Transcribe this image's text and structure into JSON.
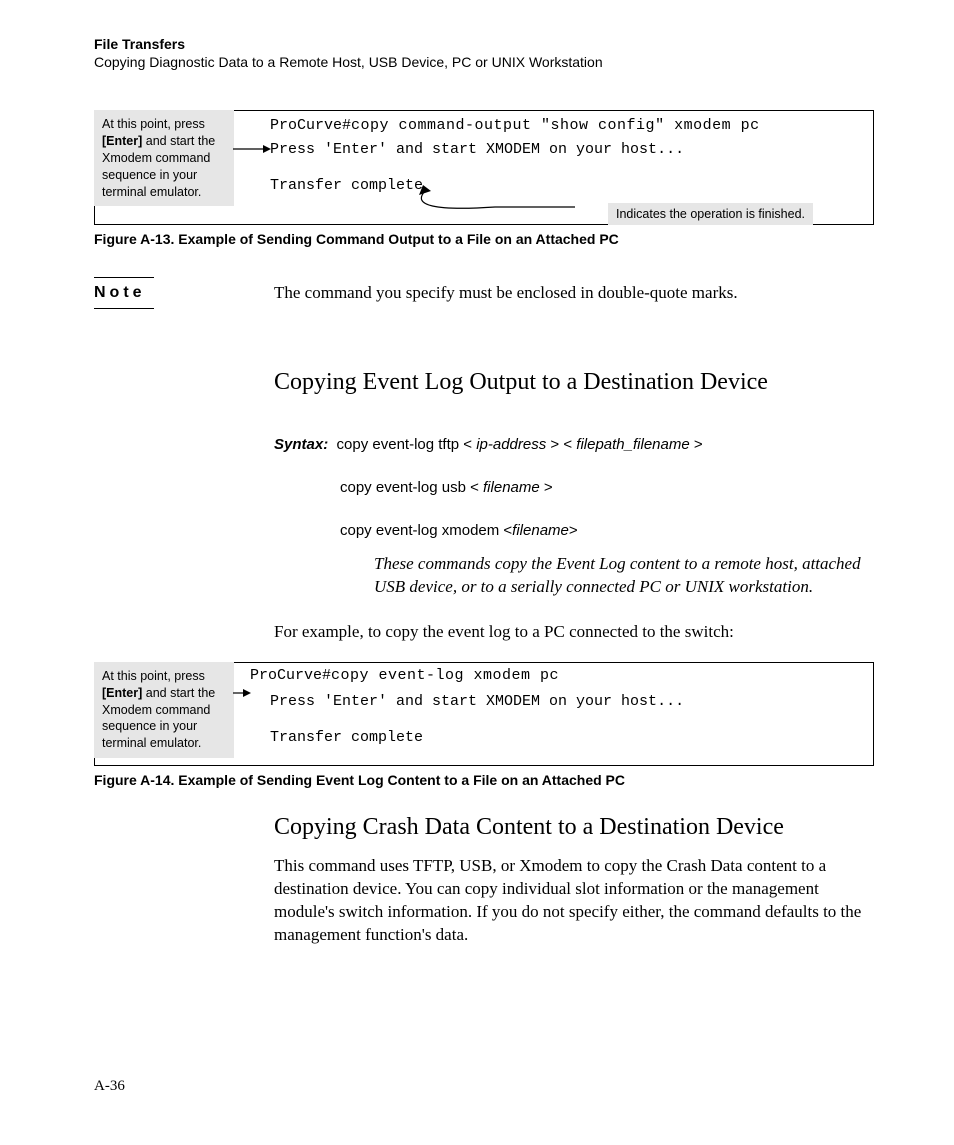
{
  "header": {
    "title": "File Transfers",
    "sub": "Copying Diagnostic Data to a Remote Host, USB Device, PC or UNIX Workstation"
  },
  "fig1": {
    "callout_left_pre": "At this point, press ",
    "callout_left_bold": "[Enter]",
    "callout_left_post": " and start the Xmodem command sequence in your terminal emulator.",
    "term_line1a": "ProCurve#",
    "term_line1b": "copy command-output \"show config\" xmodem pc",
    "term_line2": "Press 'Enter' and start XMODEM on your host...",
    "term_line3": "Transfer complete",
    "callout_right": "Indicates the operation is finished.",
    "caption": "Figure A-13.  Example of Sending Command Output to a File on an Attached PC"
  },
  "note": {
    "label": "Note",
    "body": "The command you specify must be enclosed in double-quote marks."
  },
  "section1": {
    "title": "Copying Event Log Output to a Destination Device",
    "syntax_label": "Syntax:",
    "line1_a": "copy event-log tftp < ",
    "line1_i1": "ip-address",
    "line1_b": " > < ",
    "line1_i2": "filepath_filename",
    "line1_c": " >",
    "line2_a": "copy event-log usb < ",
    "line2_i": "filename",
    "line2_b": " >",
    "line3_a": "copy event-log xmodem <",
    "line3_i": "filename",
    "line3_b": ">",
    "desc": "These commands copy the Event Log content to a remote host, attached USB device, or to a serially connected PC or UNIX workstation.",
    "example_intro": "For example, to copy the event log to a PC connected to the switch:"
  },
  "fig2": {
    "callout_left_pre": "At this point, press ",
    "callout_left_bold": "[Enter]",
    "callout_left_post": " and start the Xmodem command sequence in your terminal emulator.",
    "term_line1a": "ProCurve#",
    "term_line1b": "copy event-log xmodem pc",
    "term_line2": "Press 'Enter' and start XMODEM on your host...",
    "term_line3": "Transfer complete",
    "caption": "Figure A-14.  Example of Sending Event Log Content to a File on an Attached PC"
  },
  "section2": {
    "title": "Copying Crash Data Content to a Destination Device",
    "body": "This command uses TFTP, USB, or Xmodem to copy the Crash Data content to a destination device. You can copy individual slot information or the management module's switch information. If you do not specify either, the command defaults to the management function's data."
  },
  "page_num": "A-36"
}
